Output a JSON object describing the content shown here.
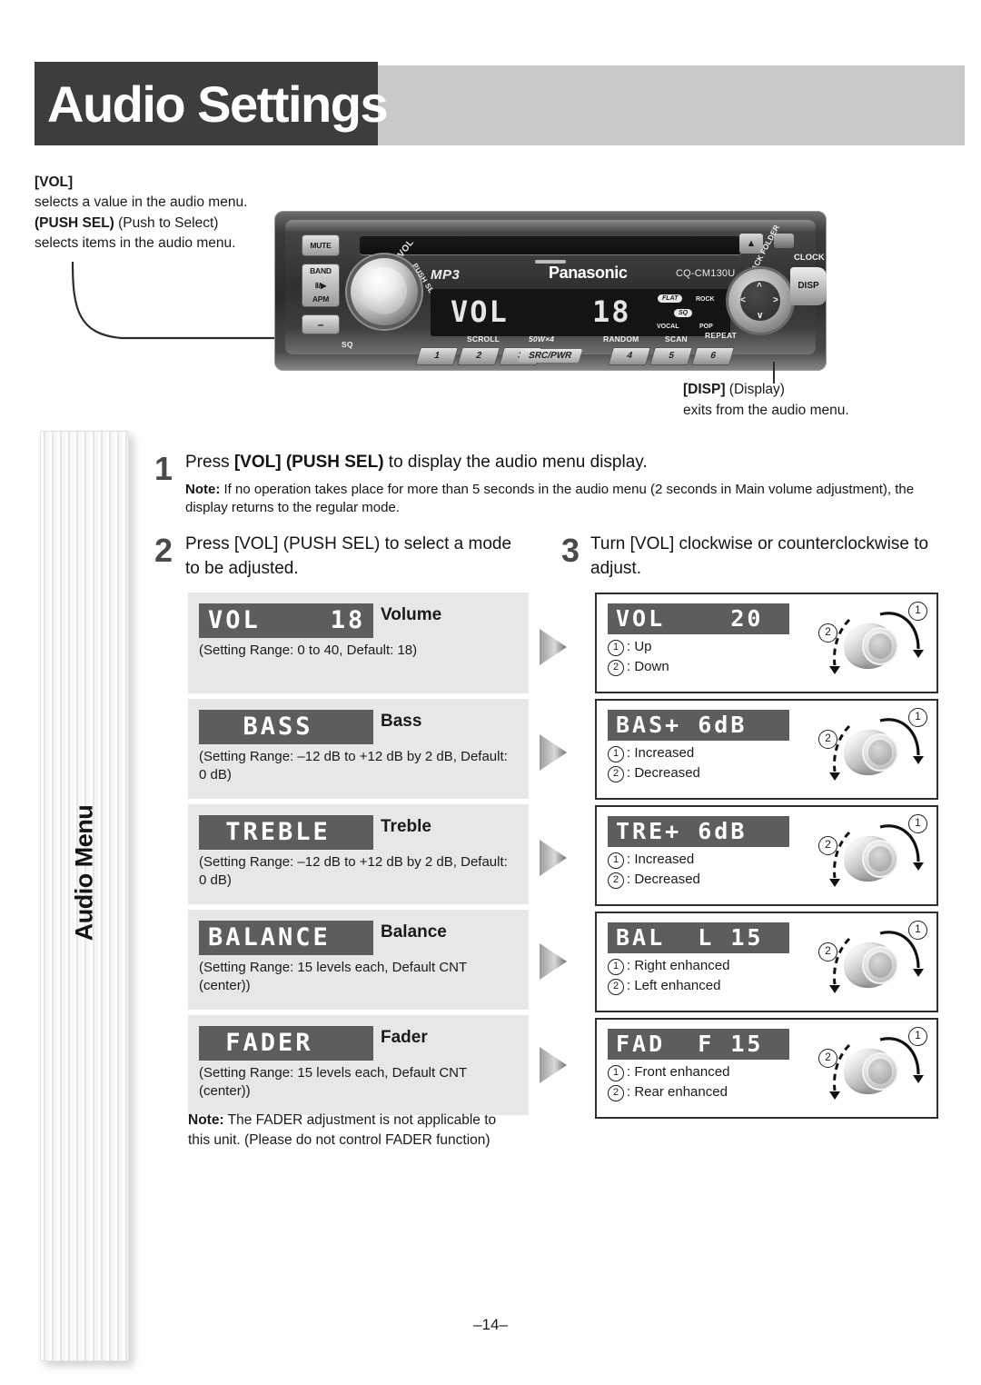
{
  "page": {
    "title": "Audio Settings",
    "page_number": "–14–"
  },
  "vol_callout": {
    "key": "[VOL]",
    "line1": "selects a value in the audio menu.",
    "key2": "(PUSH SEL)",
    "key2_suffix": " (Push to Select)",
    "line2": "selects items in the audio menu."
  },
  "disp_callout": {
    "key": "[DISP]",
    "key_suffix": " (Display)",
    "line": "exits from the audio menu."
  },
  "unit": {
    "brand": "Panasonic",
    "model": "CQ-CM130U",
    "mp3_label": "MP3",
    "mute_label": "MUTE",
    "band_label": "BAND",
    "band_sub1": "Ⅱ/▶",
    "band_sub2": "APM",
    "dash_label": "–",
    "sq_label": "SQ",
    "vol_arc_label": "VOL",
    "push_sel_arc_label": "PUSH SEL",
    "clock_label": "CLOCK",
    "disp_label": "DISP",
    "tune_track_folder_label": "TUNE / TRACK  FOLDER",
    "eject_label": "▲",
    "lcd_left": "VOL",
    "lcd_right": "18",
    "sq_flat": "FLAT",
    "sq_rock": "ROCK",
    "sq_vocal": "VOCAL",
    "sq_pop": "POP",
    "sq_center": "SQ",
    "labels_row": [
      "SCROLL",
      "50W×4",
      "RANDOM",
      "SCAN",
      "REPEAT"
    ],
    "presets": [
      "1",
      "2",
      "3",
      "4",
      "5",
      "6"
    ],
    "src_pwr": "SRC/PWR"
  },
  "tab": {
    "label": "Audio Menu"
  },
  "steps": {
    "step1": {
      "num": "1",
      "text_a": "Press ",
      "bold_a": "[VOL] (PUSH SEL)",
      "text_b": " to display the audio menu display.",
      "note_label": "Note:",
      "note_text": " If no operation takes place for more than 5 seconds in the audio menu (2 seconds in Main volume adjustment), the display returns to the regular mode."
    },
    "step2": {
      "num": "2",
      "text_a": "Press ",
      "bold_a": "[VOL] (PUSH SEL)",
      "text_b": " to select a mode to be adjusted."
    },
    "step3": {
      "num": "3",
      "text_a": "Turn ",
      "bold_a": "[VOL]",
      "text_b": " clockwise or counterclockwise to adjust."
    }
  },
  "menu_items": [
    {
      "lcd": "VOL    18",
      "title": "Volume",
      "sub": "(Setting Range: 0 to 40, Default: 18)"
    },
    {
      "lcd": "  BASS",
      "title": "Bass",
      "sub": "(Setting Range: –12 dB to +12 dB by 2 dB, Default: 0 dB)"
    },
    {
      "lcd": " TREBLE",
      "title": "Treble",
      "sub": "(Setting Range: –12 dB to +12 dB by 2 dB, Default: 0 dB)"
    },
    {
      "lcd": "BALANCE",
      "title": "Balance",
      "sub": "(Setting Range: 15 levels each, Default CNT (center))"
    },
    {
      "lcd": " FADER",
      "title": "Fader",
      "sub": "(Setting Range: 15 levels each, Default CNT (center))"
    }
  ],
  "results": [
    {
      "lcd": "VOL    20",
      "legend1": ": Up",
      "legend2": ": Down",
      "num1": "1",
      "num2": "2"
    },
    {
      "lcd": "BAS+ 6dB",
      "legend1": ": Increased",
      "legend2": ": Decreased",
      "num1": "1",
      "num2": "2"
    },
    {
      "lcd": "TRE+ 6dB",
      "legend1": ": Increased",
      "legend2": ": Decreased",
      "num1": "1",
      "num2": "2"
    },
    {
      "lcd": "BAL  L 15",
      "legend1": ": Right enhanced",
      "legend2": ": Left enhanced",
      "num1": "1",
      "num2": "2"
    },
    {
      "lcd": "FAD  F 15",
      "legend1": ": Front enhanced",
      "legend2": ": Rear enhanced",
      "num1": "1",
      "num2": "2"
    }
  ],
  "fader_note": {
    "label": "Note:",
    "text": " The FADER adjustment is not applicable to this unit. (Please do not control FADER function)"
  },
  "colors": {
    "title_bar_dark": "#3d3d3d",
    "title_bar_light": "#c9c9c9",
    "card_bg": "#e7e7e7",
    "lcd_bg": "#5d5d5d",
    "border": "#2d2d2d"
  }
}
